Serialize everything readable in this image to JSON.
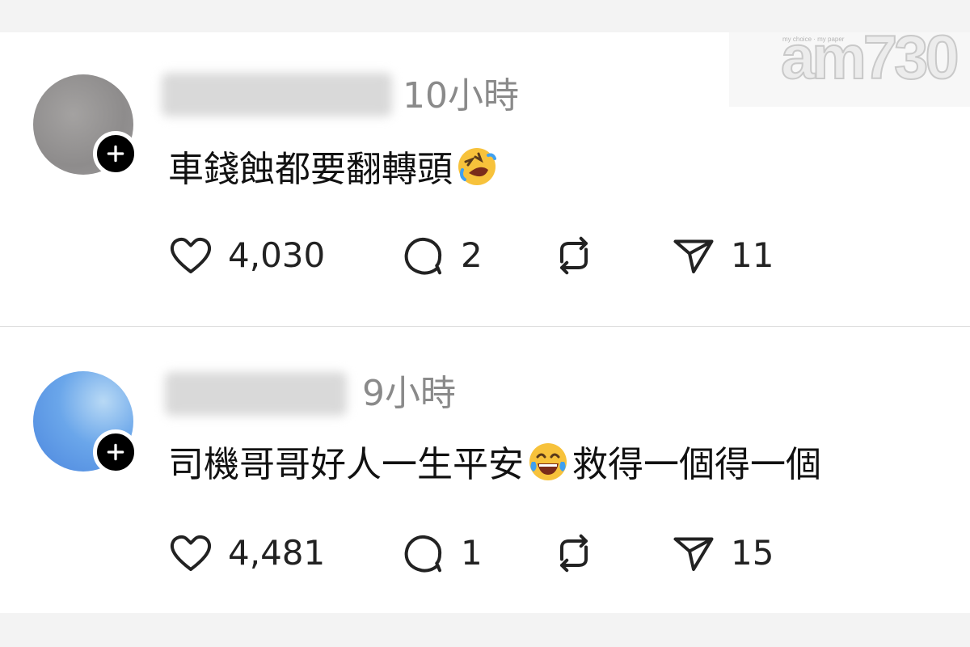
{
  "watermark": {
    "brand": "am730",
    "tagline": "my choice · my paper"
  },
  "posts": [
    {
      "time": "10小時",
      "comment_before": "車錢蝕都要翻轉頭",
      "comment_after": "",
      "emoji": "rolling-on-floor-laughing",
      "likes": "4,030",
      "replies": "2",
      "shares": "11"
    },
    {
      "time": "9小時",
      "comment_before": "司機哥哥好人一生平安",
      "comment_after": "救得一個得一個",
      "emoji": "face-with-tears-of-joy",
      "likes": "4,481",
      "replies": "1",
      "shares": "15"
    }
  ],
  "colors": {
    "accent": "#000000",
    "muted_text": "#8a8a8a",
    "emoji_yellow": "#f7c23b"
  }
}
